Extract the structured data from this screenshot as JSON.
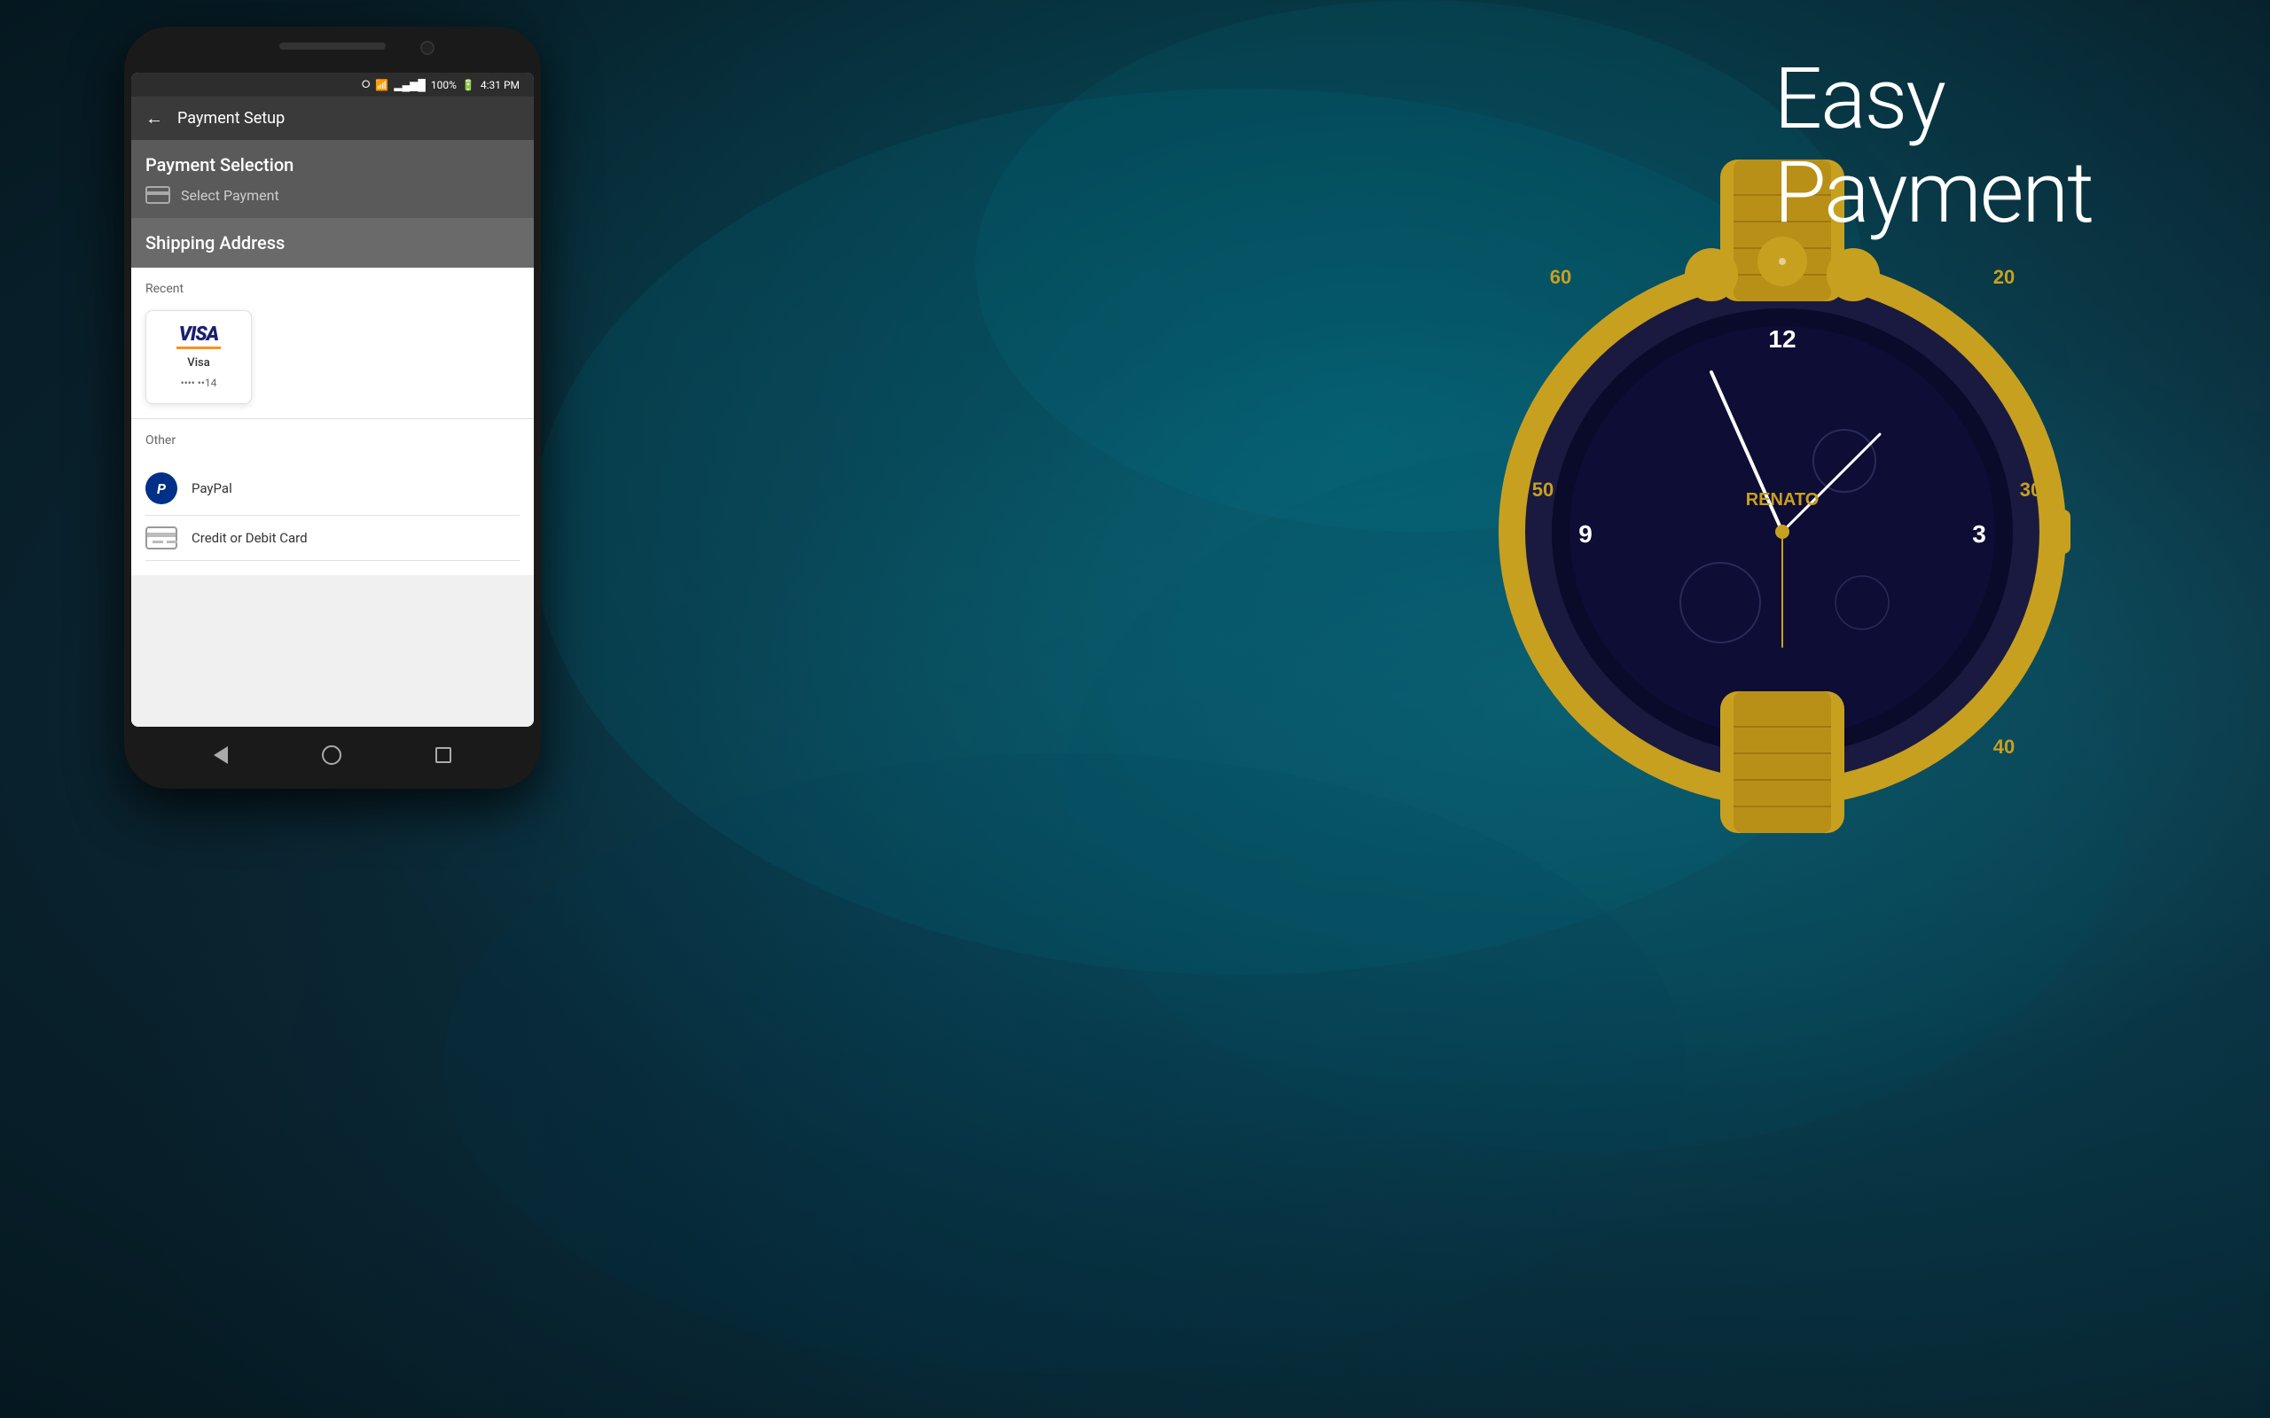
{
  "background": {
    "alt": "Ocean teal dark background"
  },
  "tagline": {
    "line1": "Easy",
    "line2": "Payment"
  },
  "phone": {
    "status_bar": {
      "time": "4:31 PM",
      "battery": "100%",
      "signal": "●●●●",
      "wifi": "WiFi"
    },
    "app_bar": {
      "title": "Payment Setup",
      "back_label": "←"
    },
    "payment_selection": {
      "title": "Payment Selection",
      "select_label": "Select Payment"
    },
    "shipping_address": {
      "title": "Shipping Address"
    },
    "recent": {
      "label": "Recent",
      "card": {
        "name": "Visa",
        "number": "•••• ••14",
        "logo": "VISA"
      }
    },
    "other": {
      "label": "Other",
      "options": [
        {
          "id": "paypal",
          "name": "PayPal",
          "icon": "paypal-icon"
        },
        {
          "id": "credit",
          "name": "Credit or Debit Card",
          "icon": "credit-card-icon"
        }
      ]
    },
    "nav": {
      "back_label": "back",
      "home_label": "home",
      "recent_label": "recent"
    }
  }
}
